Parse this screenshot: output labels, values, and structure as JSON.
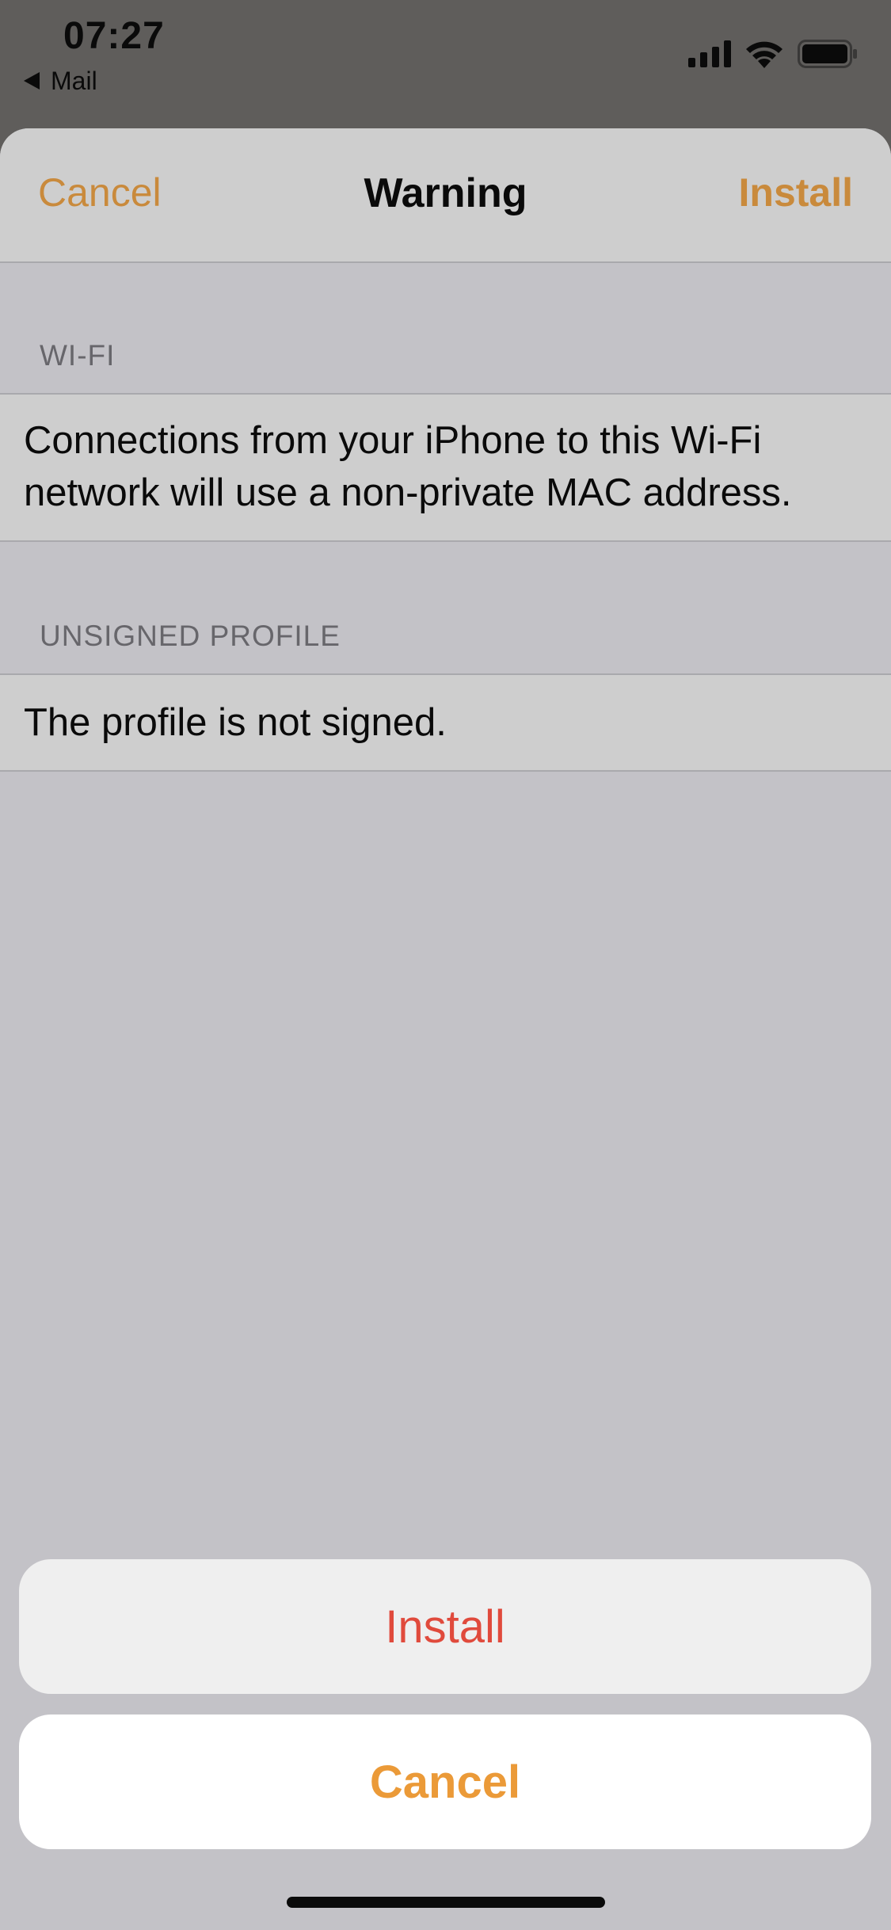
{
  "status_bar": {
    "time": "07:27",
    "back_app": "Mail",
    "icons": [
      "cellular-signal-icon",
      "wifi-icon",
      "battery-icon"
    ]
  },
  "nav": {
    "cancel_label": "Cancel",
    "title": "Warning",
    "install_label": "Install"
  },
  "sections": [
    {
      "header": "WI-FI",
      "text": "Connections from your iPhone to this Wi-Fi network will use a non-private MAC address."
    },
    {
      "header": "UNSIGNED PROFILE",
      "text": "The profile is not signed."
    }
  ],
  "action_sheet": {
    "install_label": "Install",
    "cancel_label": "Cancel"
  },
  "colors": {
    "accent": "#c98a3c",
    "destructive": "#e04a3c",
    "cancel_accent": "#eb9a38"
  }
}
